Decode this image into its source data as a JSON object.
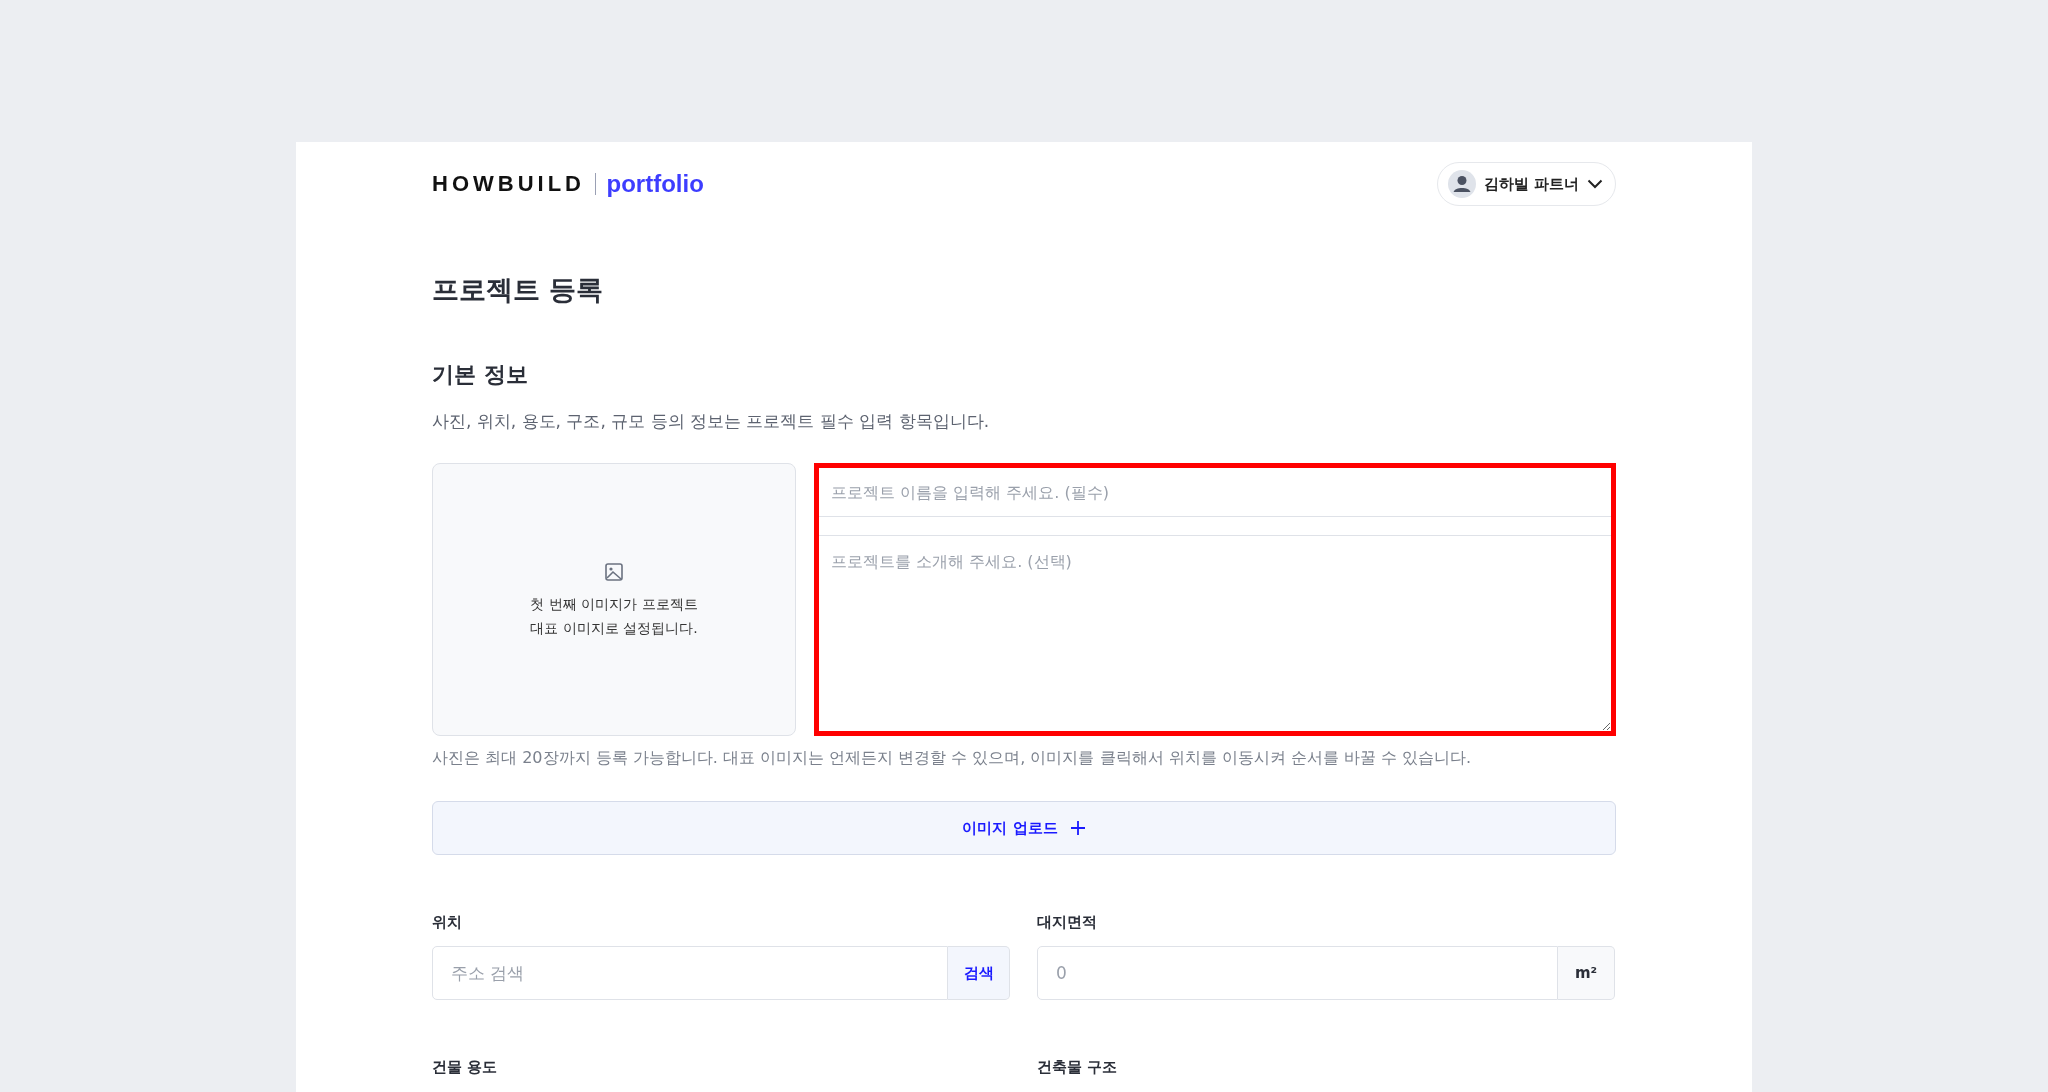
{
  "header": {
    "logo": "HOWBUILD",
    "logo_sub": "portfolio",
    "user": {
      "name": "김하빌 파트너"
    }
  },
  "page_title": "프로젝트 등록",
  "section": {
    "title": "기본 정보",
    "description": "사진, 위치, 용도, 구조, 규모 등의 정보는 프로젝트 필수 입력 항목입니다."
  },
  "image_box": {
    "lines": [
      "첫 번째 이미지가 프로젝트",
      "대표 이미지로 설정됩니다."
    ]
  },
  "project_name": {
    "placeholder": "프로젝트 이름을 입력해 주세요. (필수)"
  },
  "project_intro": {
    "placeholder": "프로젝트를 소개해 주세요. (선택)"
  },
  "highlighted": true,
  "photo_note": "사진은 최대 20장까지 등록 가능합니다. 대표 이미지는 언제든지 변경할 수 있으며, 이미지를 클릭해서 위치를 이동시켜 순서를 바꿀 수 있습니다.",
  "upload_button": "이미지 업로드",
  "fields": [
    {
      "label": "위치",
      "placeholder": "주소 검색",
      "kind": "button",
      "addon": "검색"
    },
    {
      "label": "대지면적",
      "placeholder": "0",
      "kind": "unit",
      "addon": "m²"
    }
  ],
  "next_labels": [
    "건물 용도",
    "건축물 구조"
  ]
}
